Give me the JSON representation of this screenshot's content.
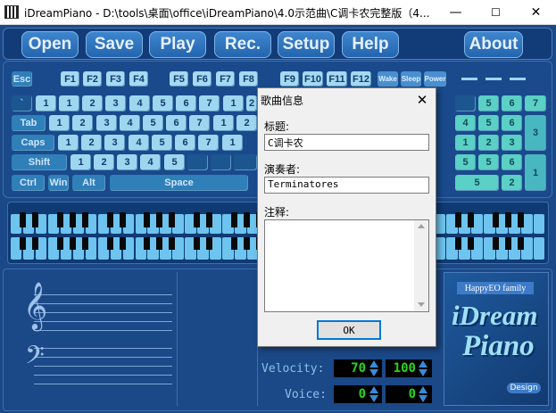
{
  "window": {
    "title": "iDreamPiano - D:\\tools\\桌面\\office\\iDreamPiano\\4.0示范曲\\C调卡农完整版（4...",
    "minimize": "—",
    "maximize": "☐",
    "close": "✕"
  },
  "menu": {
    "items": [
      "Open",
      "Save",
      "Play",
      "Rec.",
      "Setup",
      "Help",
      "About"
    ]
  },
  "keyboard": {
    "esc": "Esc",
    "f_keys": [
      "F1",
      "F2",
      "F3",
      "F4",
      "F5",
      "F6",
      "F7",
      "F8",
      "F9",
      "F10",
      "F11",
      "F12"
    ],
    "specials": [
      "Wake",
      "Sleep",
      "Power"
    ],
    "tab": "Tab",
    "caps": "Caps",
    "shift": "Shift",
    "ctrl": "Ctrl",
    "win": "Win",
    "alt": "Alt",
    "space": "Space",
    "row1_notes": [
      "1",
      "1",
      "2",
      "3",
      "4",
      "5",
      "6",
      "7",
      "1",
      "2"
    ],
    "row2_notes": [
      "1",
      "2",
      "3",
      "4",
      "5",
      "6",
      "7",
      "1",
      "2"
    ],
    "row3_notes": [
      "1",
      "2",
      "3",
      "4",
      "5",
      "6",
      "7",
      "1"
    ],
    "row4_notes": [
      "1",
      "2",
      "3",
      "4",
      "5"
    ],
    "numpad_row1": [
      "4",
      "5",
      "6",
      "7"
    ],
    "numpad_row2": [
      "1",
      "2",
      "3"
    ],
    "numpad_row3": [
      "5",
      "6"
    ],
    "numpad_big": "3",
    "numpad_tall": "1",
    "numpad_wide": "2"
  },
  "controls": {
    "velocity_label": "Velocity:",
    "velocity_left": "70",
    "velocity_right": "100",
    "voice_label": "Voice:",
    "voice_left": "0",
    "voice_right": "0"
  },
  "brand": {
    "family": "HappyEO family",
    "name_line1": "iDream",
    "name_line2": "Piano",
    "design": "Design"
  },
  "dialog": {
    "title": "歌曲信息",
    "close": "✕",
    "title_label": "标题:",
    "title_value": "C调卡农",
    "performer_label": "演奏者:",
    "performer_value": "Terminatores",
    "notes_label": "注释:",
    "ok": "OK"
  }
}
